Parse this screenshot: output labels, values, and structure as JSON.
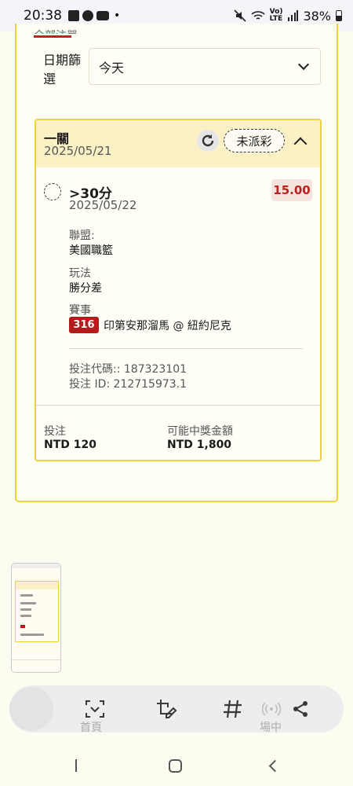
{
  "status_bar": {
    "time": "20:38",
    "dot": "•",
    "network_label_top": "Vo)",
    "network_label_bottom": "LTE",
    "battery": "38%"
  },
  "filter": {
    "tab_fragment": "全部注單",
    "label": "日期篩選",
    "selected": "今天"
  },
  "bet": {
    "type": "一關",
    "date": "2025/05/21",
    "status": "未派彩",
    "selection": ">30分",
    "selection_date": "2025/05/22",
    "odds": "15.00",
    "league_label": "聯盟:",
    "league": "美國職籃",
    "play_label": "玩法",
    "play": "勝分差",
    "match_label": "賽事",
    "match_number": "316",
    "match": "印第安那溜馬 @ 紐約尼克",
    "code_line": "投注代碼:: 187323101",
    "id_line": "投注 ID: 212715973.1",
    "stake_label": "投注",
    "stake": "NTD 120",
    "payout_label": "可能中獎金額",
    "payout": "NTD 1,800"
  },
  "toolbar": {
    "ghost_left": "首頁",
    "ghost_right": "場中"
  },
  "colors": {
    "accent_yellow": "#f1d23d",
    "header_bg": "#fcf1c4",
    "brand_red": "#b61c1c",
    "page_bg": "#fdfcf1"
  },
  "icons": {
    "status": [
      "gallery-icon",
      "chat-icon",
      "youtube-icon",
      "mute-icon",
      "wifi-icon",
      "signal-icon",
      "battery-icon"
    ],
    "toolbar": [
      "scan-text-icon",
      "crop-edit-icon",
      "hashtag-icon",
      "nearby-share-icon",
      "share-icon"
    ],
    "nav": [
      "recents-icon",
      "home-icon",
      "back-icon"
    ]
  }
}
